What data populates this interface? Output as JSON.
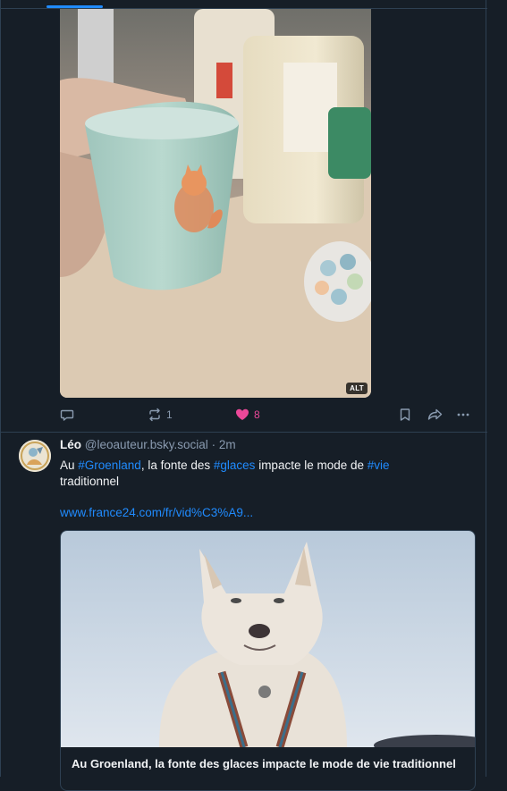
{
  "post1": {
    "image_alt_badge": "ALT",
    "actions": {
      "reply_count": "",
      "repost_count": "1",
      "like_count": "8"
    }
  },
  "post2": {
    "author_name": "Léo",
    "author_handle": "@leoauteur.bsky.social",
    "timestamp": "· 2m",
    "text_prefix": "Au ",
    "hashtag1": "#Groenland",
    "text_mid1": ", la fonte des ",
    "hashtag2": "#glaces",
    "text_mid2": " impacte le mode de ",
    "hashtag3": "#vie",
    "text_suffix": " traditionnel",
    "link": "www.france24.com/fr/vid%C3%A9...",
    "card_title": "Au Groenland, la fonte des glaces impacte le mode de vie traditionnel"
  },
  "colors": {
    "background": "#161e27",
    "accent": "#208bfe",
    "like": "#ec4899",
    "muted": "#8a9bb0"
  }
}
